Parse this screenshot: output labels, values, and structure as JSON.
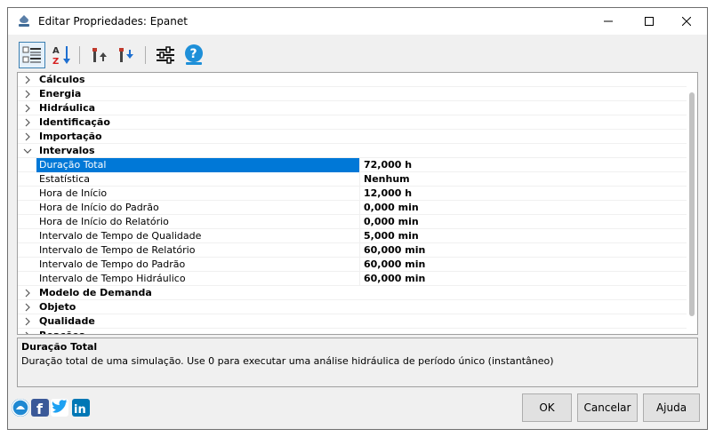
{
  "window": {
    "title": "Editar Propriedades: Epanet",
    "minimize_icon": "minimize-icon",
    "maximize_icon": "maximize-icon",
    "close_icon": "close-icon"
  },
  "toolbar": {
    "items": [
      {
        "name": "categorized-view-icon",
        "active": true
      },
      {
        "name": "sort-az-icon",
        "active": false
      },
      {
        "name": "move-up-icon",
        "active": false
      },
      {
        "name": "move-down-icon",
        "active": false
      },
      {
        "name": "settings-sliders-icon",
        "active": false
      },
      {
        "name": "help-icon",
        "active": false
      }
    ]
  },
  "grid": {
    "categories_before": [
      "Cálculos",
      "Energia",
      "Hidráulica",
      "Identificação",
      "Importação"
    ],
    "expanded_category": "Intervalos",
    "properties": [
      {
        "name": "Duração Total",
        "value": "72,000 h",
        "selected": true
      },
      {
        "name": "Estatística",
        "value": "Nenhum",
        "selected": false
      },
      {
        "name": "Hora de Início",
        "value": "12,000 h",
        "selected": false
      },
      {
        "name": "Hora de Início do Padrão",
        "value": "0,000 min",
        "selected": false
      },
      {
        "name": "Hora de Início do Relatório",
        "value": "0,000 min",
        "selected": false
      },
      {
        "name": "Intervalo de Tempo de Qualidade",
        "value": "5,000 min",
        "selected": false
      },
      {
        "name": "Intervalo de Tempo de Relatório",
        "value": "60,000 min",
        "selected": false
      },
      {
        "name": "Intervalo de Tempo do Padrão",
        "value": "60,000 min",
        "selected": false
      },
      {
        "name": "Intervalo de Tempo Hidráulico",
        "value": "60,000 min",
        "selected": false
      }
    ],
    "categories_after": [
      "Modelo de Demanda",
      "Objeto",
      "Qualidade",
      "Reações"
    ]
  },
  "description": {
    "title": "Duração Total",
    "text": "Duração total de uma simulação. Use 0 para executar uma análise hidráulica de período único (instantâneo)"
  },
  "social": [
    "web-icon",
    "facebook-icon",
    "twitter-icon",
    "linkedin-icon"
  ],
  "buttons": {
    "ok": "OK",
    "cancel": "Cancelar",
    "help": "Ajuda"
  },
  "colors": {
    "selection": "#0078d7",
    "facebook": "#3b5998",
    "twitter": "#1da1f2",
    "linkedin": "#0077b5"
  }
}
